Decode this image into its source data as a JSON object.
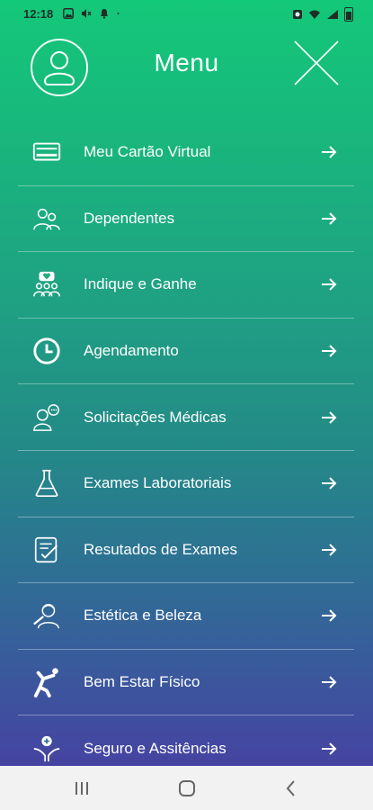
{
  "status_bar": {
    "time": "12:18",
    "left_icons": [
      "image-icon",
      "mute-icon",
      "dnd-icon",
      "dot-icon"
    ],
    "right_icons": [
      "alarm-icon",
      "wifi-icon",
      "signal-icon",
      "battery-icon"
    ]
  },
  "header": {
    "title": "Menu",
    "avatar_icon": "user-avatar-icon",
    "close_icon": "close-icon"
  },
  "menu": {
    "items": [
      {
        "label": "Meu Cartão Virtual",
        "icon": "card-icon"
      },
      {
        "label": "Dependentes",
        "icon": "people-icon"
      },
      {
        "label": "Indique e Ganhe",
        "icon": "group-heart-icon"
      },
      {
        "label": "Agendamento",
        "icon": "clock-icon"
      },
      {
        "label": "Solicitações Médicas",
        "icon": "doctor-chat-icon"
      },
      {
        "label": "Exames Laboratoriais",
        "icon": "flask-icon"
      },
      {
        "label": "Resutados de Exames",
        "icon": "checklist-icon"
      },
      {
        "label": "Estética e Beleza",
        "icon": "beauty-icon"
      },
      {
        "label": "Bem Estar Físico",
        "icon": "stretch-icon"
      },
      {
        "label": "Seguro e Assitências",
        "icon": "care-hands-icon"
      }
    ],
    "arrow_icon": "arrow-right-icon"
  },
  "nav_bar": {
    "buttons": [
      "recent-apps-icon",
      "home-icon",
      "back-icon"
    ]
  },
  "colors": {
    "gradient_top": "#14c879",
    "gradient_bottom": "#4b3aa3",
    "text": "#ffffff"
  }
}
